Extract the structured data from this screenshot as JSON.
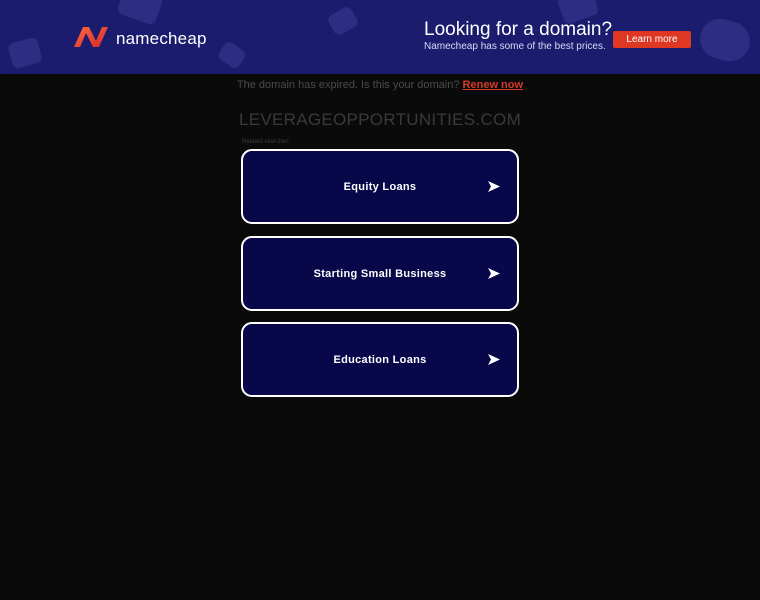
{
  "banner": {
    "brand": "namecheap",
    "logo_icon": "namecheap-logo-icon",
    "promo_title": "Looking for a domain?",
    "promo_subtitle": "Namecheap has some of the best prices.",
    "cta_label": "Learn more",
    "background_color": "#1b1c6e",
    "cta_color": "#de3723"
  },
  "notice": {
    "text": "The domain has expired. Is this your domain?",
    "link_label": "Renew now"
  },
  "domain": "LEVERAGEOPPORTUNITIES.COM",
  "related_label": "Related searches",
  "links": [
    {
      "label": "Equity Loans",
      "icon": "arrow-right-icon"
    },
    {
      "label": "Starting Small Business",
      "icon": "arrow-right-icon"
    },
    {
      "label": "Education Loans",
      "icon": "arrow-right-icon"
    }
  ],
  "colors": {
    "page_background": "#0a0a0a",
    "link_box_background": "#07074a",
    "link_box_border": "#ffffff",
    "renew_link": "#d63a2a"
  }
}
